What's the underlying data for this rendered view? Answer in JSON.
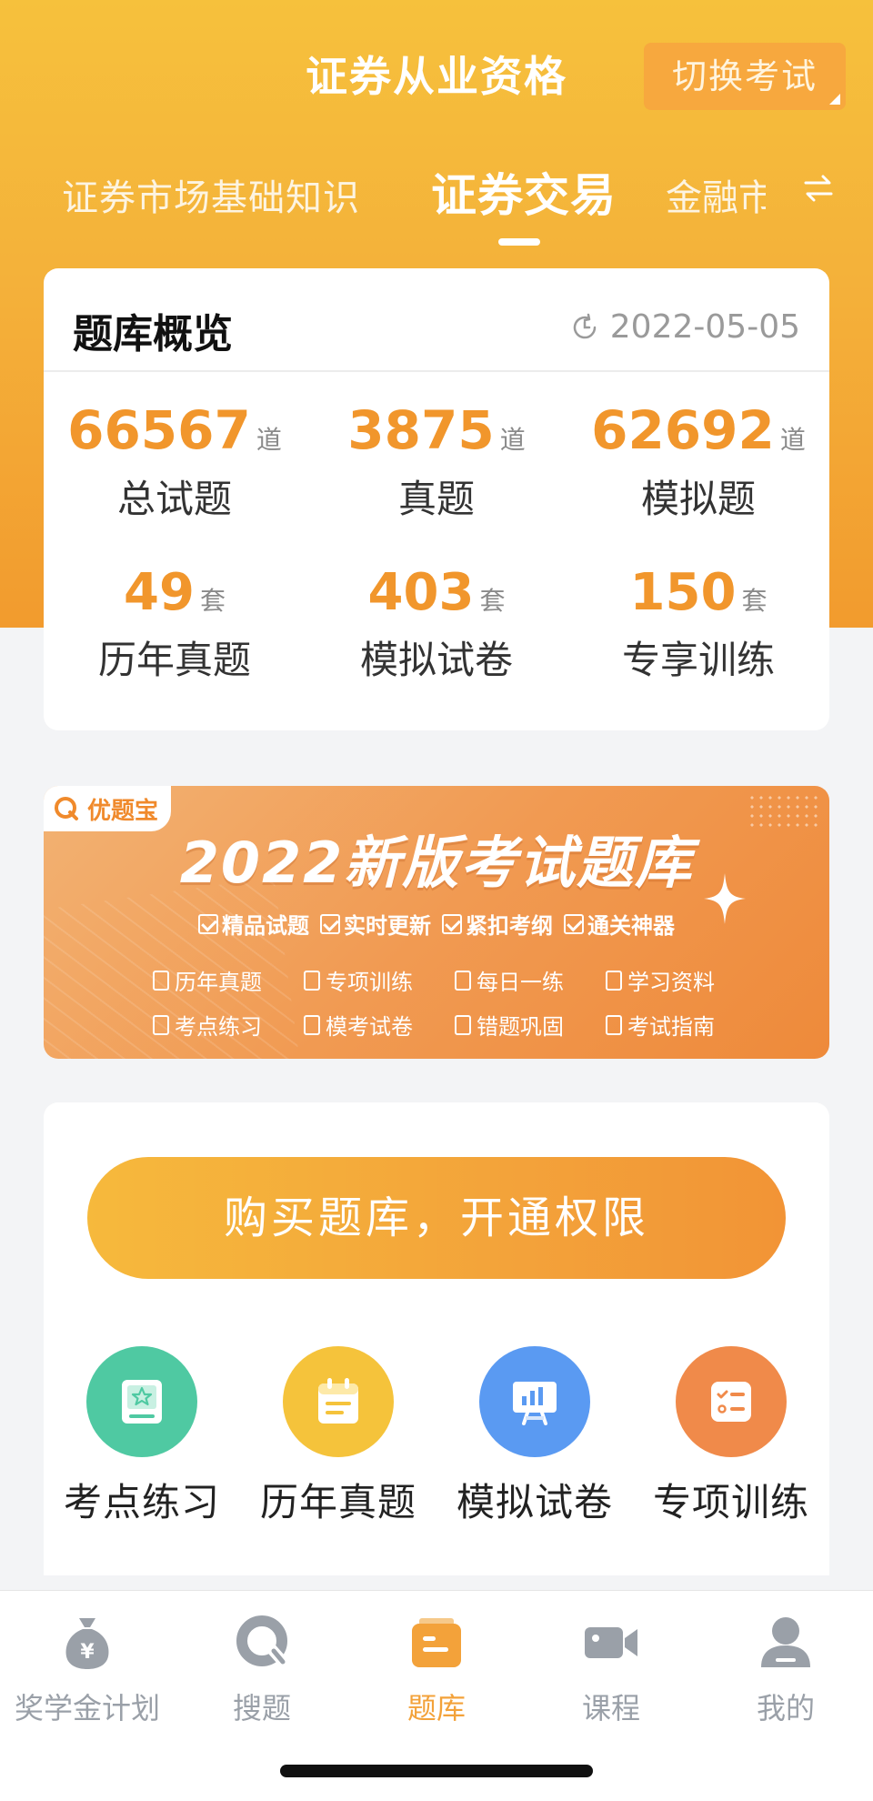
{
  "header": {
    "title": "证券从业资格",
    "switch_label": "切换考试"
  },
  "subject_tabs": [
    {
      "label": "证券市场基础知识",
      "active": false
    },
    {
      "label": "证券交易",
      "active": true
    },
    {
      "label": "金融市",
      "active": false
    }
  ],
  "overview": {
    "title": "题库概览",
    "date": "2022-05-05",
    "stats": [
      {
        "value": "66567",
        "unit": "道",
        "label": "总试题"
      },
      {
        "value": "3875",
        "unit": "道",
        "label": "真题"
      },
      {
        "value": "62692",
        "unit": "道",
        "label": "模拟题"
      },
      {
        "value": "49",
        "unit": "套",
        "label": "历年真题"
      },
      {
        "value": "403",
        "unit": "套",
        "label": "模拟试卷"
      },
      {
        "value": "150",
        "unit": "套",
        "label": "专享训练"
      }
    ]
  },
  "banner": {
    "brand": "优题宝",
    "title": "2022新版考试题库",
    "tags": [
      "精品试题",
      "实时更新",
      "紧扣考纲",
      "通关神器"
    ],
    "features": [
      "历年真题",
      "专项训练",
      "每日一练",
      "学习资料",
      "考点练习",
      "模考试卷",
      "错题巩固",
      "考试指南"
    ]
  },
  "buy_button": "购买题库，开通权限",
  "actions": [
    {
      "label": "考点练习",
      "icon": "star-card-icon",
      "color": "#4fc9a2"
    },
    {
      "label": "历年真题",
      "icon": "calendar-icon",
      "color": "#f5c33b"
    },
    {
      "label": "模拟试卷",
      "icon": "presentation-board-icon",
      "color": "#5a9af2"
    },
    {
      "label": "专项训练",
      "icon": "checklist-icon",
      "color": "#f08a4a"
    }
  ],
  "tabbar": [
    {
      "label": "奖学金计划",
      "icon": "money-bag-icon",
      "active": false
    },
    {
      "label": "搜题",
      "icon": "search-icon",
      "active": false
    },
    {
      "label": "题库",
      "icon": "question-bank-icon",
      "active": true
    },
    {
      "label": "课程",
      "icon": "video-camera-icon",
      "active": false
    },
    {
      "label": "我的",
      "icon": "user-icon",
      "active": false
    }
  ],
  "colors": {
    "accent": "#f3a23a",
    "number": "#f1962c",
    "inactive_tab": "#9aa0a8"
  }
}
